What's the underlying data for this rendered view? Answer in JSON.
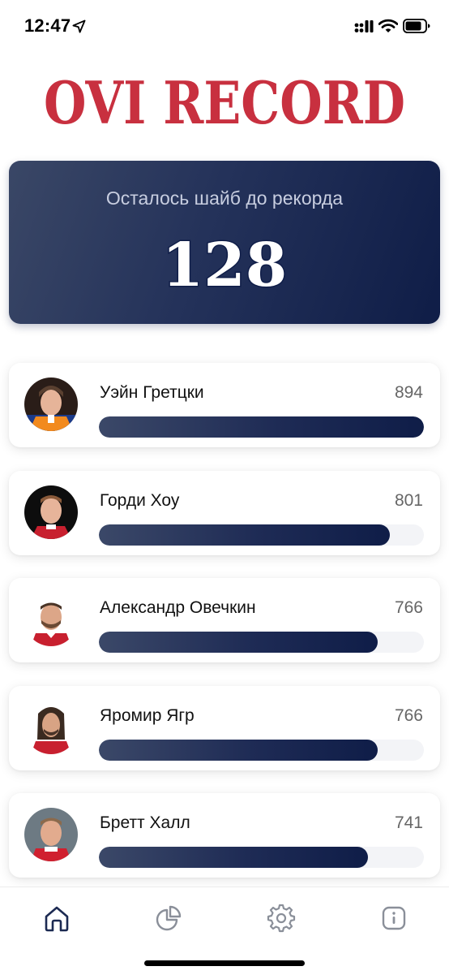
{
  "status_bar": {
    "time": "12:47"
  },
  "app": {
    "title": "OVI RECORD",
    "title_color": "#c8303f"
  },
  "counter": {
    "label": "Осталось шайб до рекорда",
    "value": "128"
  },
  "players": [
    {
      "name": "Уэйн Гретцки",
      "goals": "894",
      "progress": 1.0,
      "avatar_icon": "player-photo-gretzky"
    },
    {
      "name": "Горди Хоу",
      "goals": "801",
      "progress": 0.896,
      "avatar_icon": "player-photo-howe"
    },
    {
      "name": "Александр Овечкин",
      "goals": "766",
      "progress": 0.857,
      "avatar_icon": "player-photo-ovechkin"
    },
    {
      "name": "Яромир Ягр",
      "goals": "766",
      "progress": 0.857,
      "avatar_icon": "player-photo-jagr"
    },
    {
      "name": "Бретт Халл",
      "goals": "741",
      "progress": 0.829,
      "avatar_icon": "player-photo-hull"
    }
  ],
  "tabs": [
    {
      "icon": "home-icon",
      "active": true
    },
    {
      "icon": "pie-chart-icon",
      "active": false
    },
    {
      "icon": "gear-icon",
      "active": false
    },
    {
      "icon": "info-icon",
      "active": false
    }
  ],
  "colors": {
    "accent_dark": "#0f1d48",
    "tab_active": "#1c2a52",
    "tab_inactive": "#8a8f99"
  }
}
